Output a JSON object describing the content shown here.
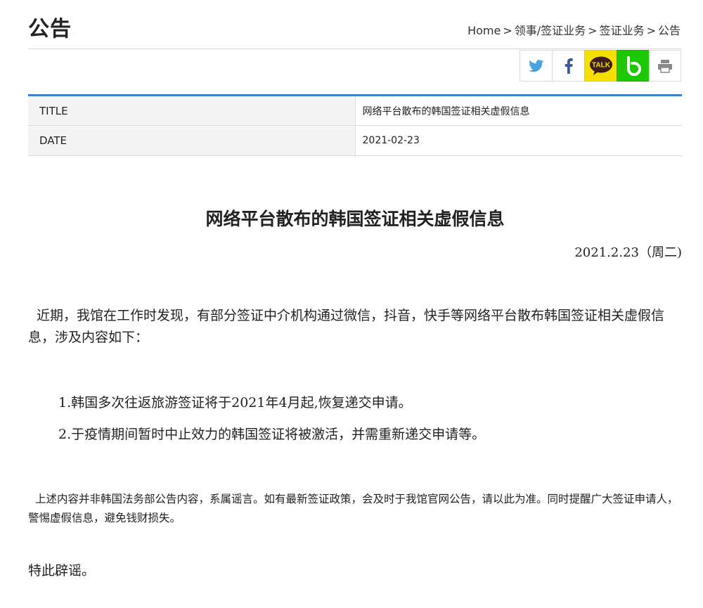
{
  "header": {
    "title": "公告",
    "breadcrumb": {
      "home": "Home",
      "separator": ">",
      "level1": "领事/签证业务",
      "level2": "签证业务",
      "current": "公告"
    }
  },
  "share": {
    "buttons": [
      {
        "name": "twitter-icon",
        "color": "#4aa3df"
      },
      {
        "name": "facebook-icon",
        "color": "#3b5998"
      },
      {
        "name": "kakaotalk-icon",
        "label": "TALK",
        "color": "#f6e000"
      },
      {
        "name": "band-icon",
        "color": "#1ec800"
      },
      {
        "name": "print-icon",
        "color": "#888888"
      }
    ],
    "kakao_label": "TALK"
  },
  "info": {
    "title_label": "TITLE",
    "title_value": "网络平台散布的韩国签证相关虚假信息",
    "date_label": "DATE",
    "date_value": "2021-02-23"
  },
  "article": {
    "heading": "网络平台散布的韩国签证相关虚假信息",
    "date": "2021.2.23（周二)",
    "intro": "近期，我馆在工作时发现，有部分签证中介机构通过微信，抖音，快手等网络平台散布韩国签证相关虚假信息，涉及内容如下：",
    "items": [
      "1.韩国多次往返旅游签证将于2021年4月起,恢复递交申请。",
      "2.于疫情期间暂时中止效力的韩国签证将被激活，并需重新递交申请等。"
    ],
    "notice": "上述内容并非韩国法务部公告内容，系属谣言。如有最新签证政策，会及时于我馆官网公告，请以此为准。同时提醒广大签证申请人，警惕虚假信息，避免钱财损失。",
    "closing": "特此辟谣。"
  },
  "colors": {
    "accent_border": "#3c82cc",
    "table_label_bg": "#f4f4f4"
  }
}
